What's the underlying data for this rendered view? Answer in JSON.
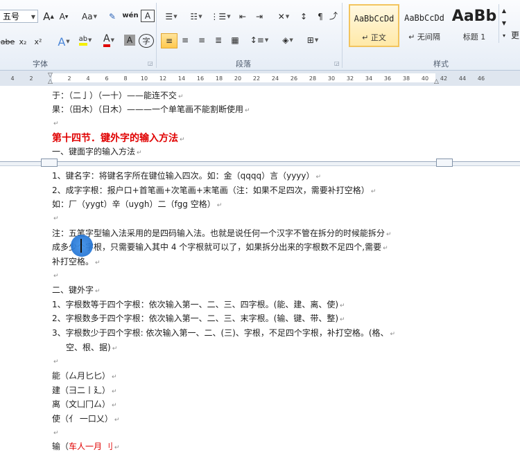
{
  "ribbon": {
    "font_group": "字体",
    "paragraph_group": "段落",
    "styles_group": "样式",
    "font_size": "五号",
    "grow_font": "A",
    "shrink_font": "A",
    "change_case": "Aa",
    "pinyin": "wén",
    "border_char": "A",
    "strikethrough": "abe",
    "subscript": "x₂",
    "superscript": "x²",
    "text_effect": "A",
    "highlight": "ab",
    "font_color": "A",
    "shading_char": "A",
    "enclose_char": "字",
    "styles": [
      {
        "preview": "AaBbCcDd",
        "name": "↵ 正文",
        "selected": true
      },
      {
        "preview": "AaBbCcDd",
        "name": "↵ 无间隔",
        "selected": false
      },
      {
        "preview": "AaBb",
        "name": "标题 1",
        "selected": false
      }
    ],
    "more_label": "更"
  },
  "ruler": {
    "ticks": [
      "4",
      "2",
      "2",
      "4",
      "6",
      "8",
      "10",
      "12",
      "14",
      "16",
      "18",
      "20",
      "22",
      "24",
      "26",
      "28",
      "30",
      "32",
      "34",
      "36",
      "38",
      "40",
      "42",
      "44",
      "46"
    ]
  },
  "document": {
    "lines": [
      {
        "text": "于：（二亅）（一十）——能连不交"
      },
      {
        "text": "果：（田木）（日木）———一个单笔画不能割断使用"
      },
      {
        "text": ""
      },
      {
        "text": "第十四节．键外字的输入方法",
        "style": "heading"
      },
      {
        "text": "一、键面字的输入方法"
      },
      {
        "text": "1、键名字：将键名字所在键位输入四次。如：金（qqqq）言（yyyy）"
      },
      {
        "text": "2、成字字根：报户口+首笔画+次笔画+末笔画（注：如果不足四次，需要补打空格）"
      },
      {
        "text": "如：厂（yygt）辛（uygh）二（fgg 空格）"
      },
      {
        "text": ""
      },
      {
        "text": "注：五笔字型输入法采用的是四码输入法。也就是说任何一个汉字不管在拆分的时候能拆分"
      },
      {
        "text": "成多少个字根，只需要输入其中 4 个字根就可以了，如果拆分出来的字根数不足四个,需要"
      },
      {
        "text": "补打空格。"
      },
      {
        "text": ""
      },
      {
        "text": "二、键外字"
      },
      {
        "text": "1、字根数等于四个字根：依次输入第一、二、三、四字根。(能、建、离、使)"
      },
      {
        "text": "2、字根数多于四个字根：依次输入第一、二、三、末字根。(输、键、带、整)"
      },
      {
        "text": "3、字根数少于四个字根: 依次输入第一、二、(三)、字根，不足四个字根，补打空格。(格、"
      },
      {
        "text": "空、根、据)",
        "indent": true
      },
      {
        "text": ""
      },
      {
        "text": "能（厶月匕匕）"
      },
      {
        "text": "建（彐二丨廴）"
      },
      {
        "text": "离（文凵冂厶）"
      },
      {
        "text": "使（亻 一口乂）"
      },
      {
        "text": ""
      },
      {
        "text": "输（",
        "tail_red": "车人一月 刂",
        "style": "partial-red"
      }
    ]
  },
  "colors": {
    "heading": "#e00000",
    "accent_selected_style": "#f2c45e",
    "cursor": "#2476d6"
  }
}
